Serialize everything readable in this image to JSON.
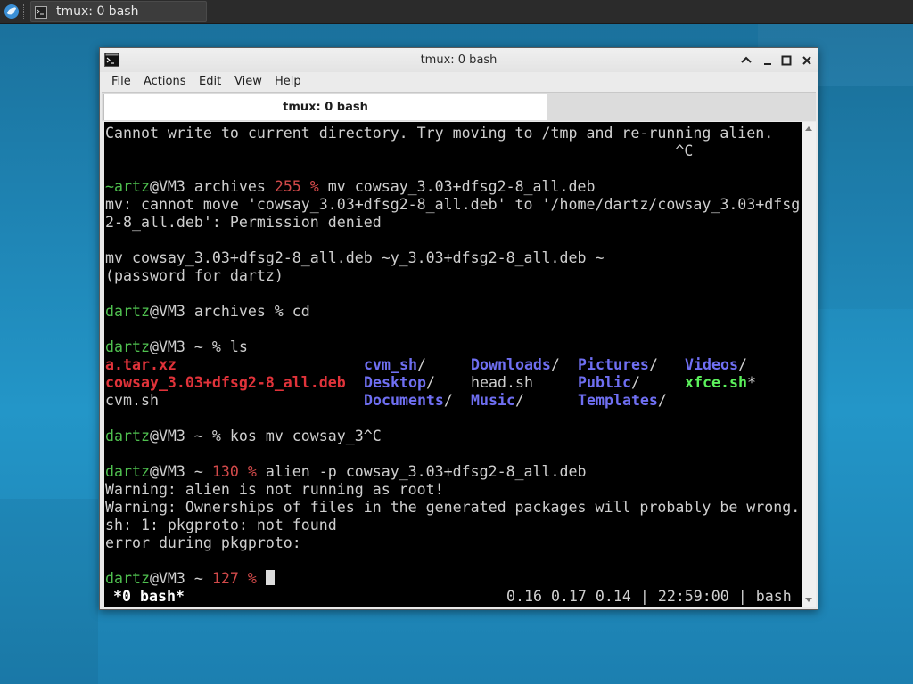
{
  "taskbar": {
    "task_label": "tmux: 0 bash"
  },
  "window": {
    "title": "tmux: 0 bash",
    "menu": [
      "File",
      "Actions",
      "Edit",
      "View",
      "Help"
    ],
    "tab_label": "tmux: 0 bash"
  },
  "terminal": {
    "line1": "Cannot write to current directory. Try moving to /tmp and re-running alien.",
    "line2": "                                                                ^C",
    "cmd1": {
      "user": "~artz",
      "host": "@VM3 archives ",
      "code": "255 %",
      "cmd": " mv cowsay_3.03+dfsg2-8_all.deb"
    },
    "line4": "mv: cannot move 'cowsay_3.03+dfsg2-8_all.deb' to '/home/dartz/cowsay_3.03+dfsg",
    "line5": "2-8_all.deb': Permission denied",
    "line7": "mv cowsay_3.03+dfsg2-8_all.deb ~y_3.03+dfsg2-8_all.deb ~",
    "line8": "(password for dartz)",
    "cmd2": {
      "user": "dartz",
      "rest": "@VM3 archives % cd"
    },
    "cmd3": {
      "user": "dartz",
      "rest": "@VM3 ~ % ls"
    },
    "ls": {
      "a_tar": "a.tar.xz",
      "cowsay_deb": "cowsay_3.03+dfsg2-8_all.deb",
      "cvm_sh_file": "cvm.sh",
      "cvm_sh_dir": "cvm_sh",
      "desktop": "Desktop",
      "documents": "Documents",
      "downloads": "Downloads",
      "head_sh": "head.sh",
      "music": "Music",
      "pictures": "Pictures",
      "public": "Public",
      "templates": "Templates",
      "videos": "Videos",
      "xfce_sh": "xfce.sh",
      "slash": "/",
      "star": "*"
    },
    "cmd4": {
      "user": "dartz",
      "rest": "@VM3 ~ % kos mv cowsay_3^C"
    },
    "cmd5": {
      "user": "dartz",
      "host": "@VM3 ~ ",
      "code": "130 %",
      "cmd": " alien -p cowsay_3.03+dfsg2-8_all.deb"
    },
    "out1": "Warning: alien is not running as root!",
    "out2": "Warning: Ownerships of files in the generated packages will probably be wrong.",
    "out3": "sh: 1: pkgproto: not found",
    "out4": "error during pkgproto:",
    "cmd6": {
      "user": "dartz",
      "host": "@VM3 ~ ",
      "code": "127 %"
    },
    "status_left": "*0 bash*",
    "status_right": "0.16 0.17 0.14 | 22:59:00 | bash"
  }
}
